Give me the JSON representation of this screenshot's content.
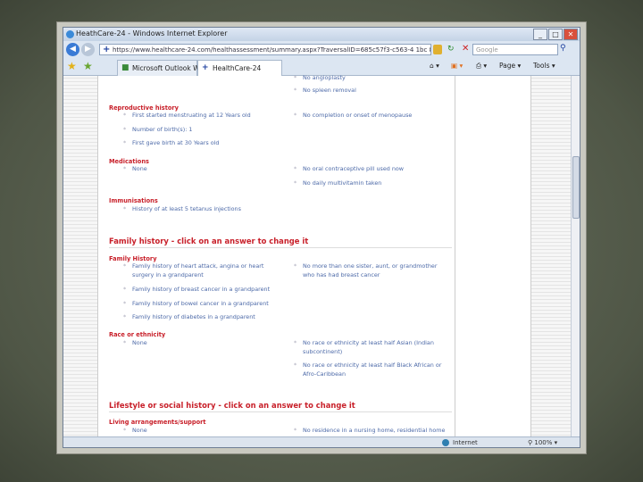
{
  "window": {
    "title": "HeathCare-24 - Windows Internet Explorer",
    "url": "https://www.healthcare-24.com/healthassessment/summary.aspx?TraversalID=685c57f3-c563-4 1bc 8b4c c",
    "search_placeholder": "Google"
  },
  "tabs": [
    {
      "label": "Microsoft Outlook We..."
    },
    {
      "label": "HealthCare-24"
    }
  ],
  "toolbar": {
    "page": "Page ▾",
    "tools": "Tools ▾"
  },
  "content": {
    "top_items": [
      "No angioplasty",
      "No spleen removal"
    ],
    "reproductive": {
      "title": "Reproductive history",
      "left": [
        "First started menstruating at 12 Years old",
        "Number of birth(s): 1",
        "First gave birth at 30 Years old"
      ],
      "right": [
        "No completion or onset of menopause"
      ]
    },
    "medications": {
      "title": "Medications",
      "left": [
        "None"
      ],
      "right": [
        "No oral contraceptive pill used now",
        "No daily multivitamin taken"
      ]
    },
    "immunisations": {
      "title": "Immunisations",
      "left": [
        "History of at least 5 tetanus injections"
      ]
    },
    "family_section": "Family history - click on an answer to change it",
    "family": {
      "title": "Family History",
      "left": [
        "Family history of heart attack, angina or heart\nsurgery in a grandparent",
        "Family history of breast cancer in a grandparent",
        "Family history of bowel cancer in a grandparent",
        "Family history of diabetes in a grandparent"
      ],
      "right": [
        "No more than one sister, aunt, or grandmother\nwho has had breast cancer"
      ]
    },
    "race": {
      "title": "Race or ethnicity",
      "left": [
        "None"
      ],
      "right": [
        "No race or ethnicity at least half Asian (Indian\nsubcontinent)",
        "No race or ethnicity at least half Black African or\nAfro-Caribbean"
      ]
    },
    "lifestyle_section": "Lifestyle or social history - click on an answer to change it",
    "living": {
      "title": "Living arrangements/support",
      "left": [
        "None"
      ],
      "right": [
        "No residence in a nursing home, residential home"
      ]
    }
  },
  "status": {
    "zone": "Internet",
    "zoom": "100%"
  }
}
